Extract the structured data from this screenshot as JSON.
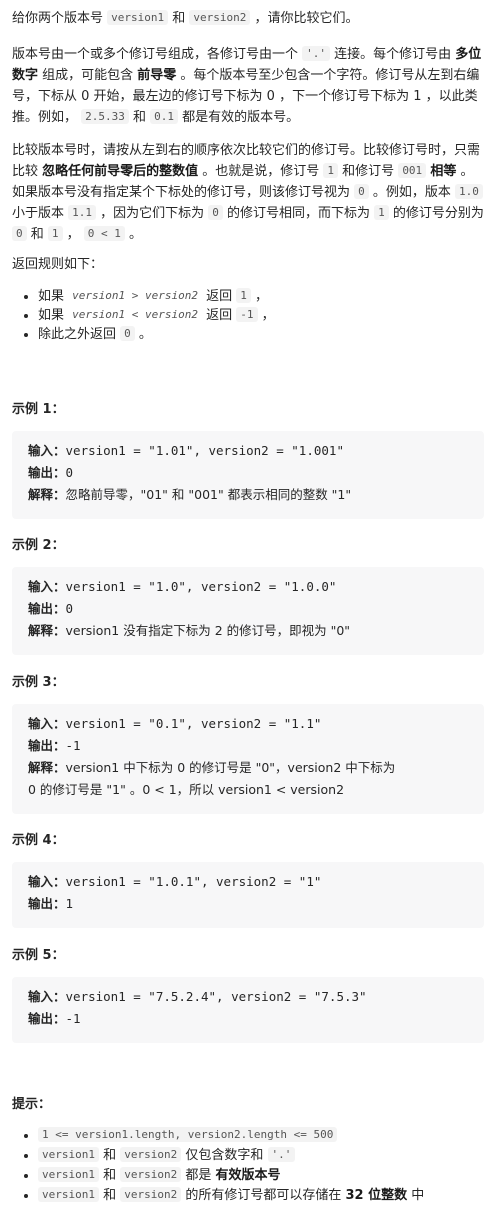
{
  "intro": {
    "t1": "给你两个版本号 ",
    "c1": "version1",
    "t2": " 和 ",
    "c2": "version2",
    "t3": " ，请你比较它们。"
  },
  "para2": {
    "t1": "版本号由一个或多个修订号组成，各修订号由一个 ",
    "c1": "'.'",
    "t2": " 连接。每个修订号由 ",
    "b1": "多位数字",
    "t3": " 组成，可能包含 ",
    "b2": "前导零",
    "t4": " 。每个版本号至少包含一个字符。修订号从左到右编号，下标从 0 开始，最左边的修订号下标为 0 ，下一个修订号下标为 1 ，以此类推。例如， ",
    "c2": "2.5.33",
    "t5": " 和 ",
    "c3": "0.1",
    "t6": " 都是有效的版本号。"
  },
  "para3": {
    "t1": "比较版本号时，请按从左到右的顺序依次比较它们的修订号。比较修订号时，只需比较 ",
    "b1": "忽略任何前导零后的整数值",
    "t2": " 。也就是说，修订号 ",
    "c1": "1",
    "t3": " 和修订号 ",
    "c2": "001",
    "t4": " ",
    "b2": "相等",
    "t5": " 。如果版本号没有指定某个下标处的修订号，则该修订号视为 ",
    "c3": "0",
    "t6": " 。例如，版本 ",
    "c4": "1.0",
    "t7": " 小于版本 ",
    "c5": "1.1",
    "t8": " ，因为它们下标为 ",
    "c6": "0",
    "t9": " 的修订号相同，而下标为 ",
    "c7": "1",
    "t10": " 的修订号分别为 ",
    "c8": "0",
    "t11": " 和 ",
    "c9": "1",
    "t12": " ， ",
    "c10": "0 < 1",
    "t13": " 。"
  },
  "rules_title": "返回规则如下：",
  "rules": [
    {
      "pre": "如果 ",
      "code": "version1  >  version2",
      "post": " 返回 ",
      "val": "1",
      "end": " ，"
    },
    {
      "pre": "如果 ",
      "code": "version1  <  version2",
      "post": " 返回 ",
      "val": "-1",
      "end": " ，"
    },
    {
      "pre": "除此之外返回 ",
      "code": "",
      "post": "",
      "val": "0",
      "end": " 。"
    }
  ],
  "labels": {
    "input": "输入：",
    "output": "输出：",
    "explain": "解释："
  },
  "examples": [
    {
      "title": "示例 1：",
      "input": "version1 = \"1.01\", version2 = \"1.001\"",
      "output": "0",
      "explain": "忽略前导零，\"01\" 和 \"001\" 都表示相同的整数 \"1\""
    },
    {
      "title": "示例 2：",
      "input": "version1 = \"1.0\", version2 = \"1.0.0\"",
      "output": "0",
      "explain": "version1 没有指定下标为 2 的修订号，即视为 \"0\""
    },
    {
      "title": "示例 3：",
      "input": "version1 = \"0.1\", version2 = \"1.1\"",
      "output": "-1",
      "explain": "version1 中下标为 0 的修订号是 \"0\"，version2 中下标为",
      "explain2": "0 的修订号是 \"1\" 。0 < 1，所以 version1 < version2"
    },
    {
      "title": "示例 4：",
      "input": "version1 = \"1.0.1\", version2 = \"1\"",
      "output": "1"
    },
    {
      "title": "示例 5：",
      "input": "version1 = \"7.5.2.4\", version2 = \"7.5.3\"",
      "output": "-1"
    }
  ],
  "hints_title": "提示：",
  "hints": [
    {
      "c1": "1 <= version1.length, version2.length <= 500"
    },
    {
      "c1": "version1",
      "t1": " 和 ",
      "c2": "version2",
      "t2": " 仅包含数字和 ",
      "c3": "'.'"
    },
    {
      "c1": "version1",
      "t1": " 和 ",
      "c2": "version2",
      "t2": " 都是 ",
      "b1": "有效版本号"
    },
    {
      "c1": "version1",
      "t1": " 和 ",
      "c2": "version2",
      "t2": " 的所有修订号都可以存储在 ",
      "b1": "32 位整数",
      "t3": " 中"
    }
  ]
}
